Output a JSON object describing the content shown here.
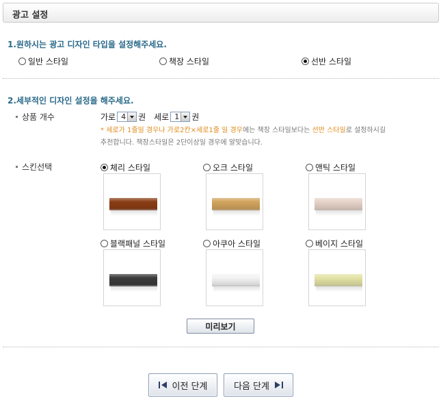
{
  "header": {
    "title": "광고 설정"
  },
  "section1": {
    "title": "1.원하시는 광고 디자인 타입을 설정해주세요.",
    "options": [
      {
        "label": "일반 스타일",
        "selected": false
      },
      {
        "label": "책장 스타일",
        "selected": false
      },
      {
        "label": "선반 스타일",
        "selected": true
      }
    ]
  },
  "section2": {
    "title": "2.세부적인 디자인 설정을 해주세요.",
    "product_count": {
      "label": "상품 개수",
      "cols_label": "가로",
      "cols_value": "4",
      "rows_label": "세로",
      "rows_value": "1",
      "unit": "권"
    },
    "note": {
      "star": "* ",
      "hl1": "세로가 1줄일 경우나 가로2칸×세로1줄 일 경우",
      "mid": "에는 책장 스타일보다는 ",
      "hl2": "선반 스타일",
      "tail": "로 설정하시길",
      "line2": "추천합니다. 책장스타일은 2단이상일 경우에 알맞습니다."
    },
    "skin": {
      "label": "스킨선택",
      "options": [
        {
          "label": "체리 스타일",
          "selected": true,
          "color": "#8a3d14"
        },
        {
          "label": "오크 스타일",
          "selected": false,
          "color": "#d2a35d"
        },
        {
          "label": "앤틱 스타일",
          "selected": false,
          "color": "#e6d3c8"
        },
        {
          "label": "블랙패널 스타일",
          "selected": false,
          "color": "#3a3a3a"
        },
        {
          "label": "아쿠아 스타일",
          "selected": false,
          "color": "#f2f2f2"
        },
        {
          "label": "베이지 스타일",
          "selected": false,
          "color": "#e3e2a6"
        }
      ]
    },
    "preview_button": "미리보기"
  },
  "nav": {
    "prev": "이전 단계",
    "next": "다음 단계"
  }
}
